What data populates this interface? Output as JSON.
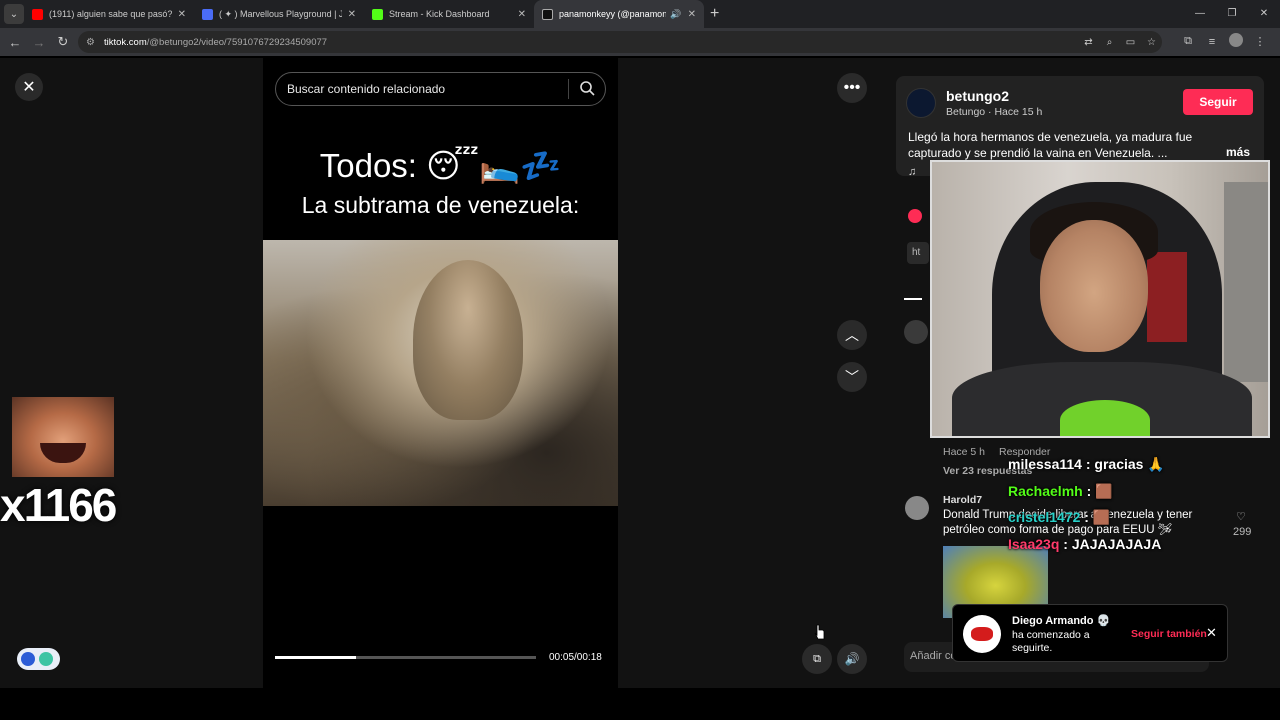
{
  "browser": {
    "tabs": [
      {
        "title": "(1911) alguien sabe que pasó?",
        "fav_color": "#ff0000"
      },
      {
        "title": "( ✦ ) Marvellous Playground | Ju",
        "fav_color": "#4a6cf7"
      },
      {
        "title": "Stream - Kick Dashboard",
        "fav_color": "#53fc18"
      },
      {
        "title": "panamonkeyy (@panamon",
        "fav_color": "#ffffff"
      }
    ],
    "url_domain": "tiktok.com",
    "url_path": "/@betungo2/video/7591076729234509077"
  },
  "video": {
    "search_placeholder": "Buscar contenido relacionado",
    "caption_line1": "Todos: 😴🛌💤",
    "caption_line2": "La subtrama de venezuela:",
    "time": "00:05/00:18",
    "progress": 0.31
  },
  "overlay": {
    "count": "x1166"
  },
  "author": {
    "username": "betungo2",
    "subtitle": "Betungo · Hace 15 h",
    "follow_label": "Seguir",
    "description": "Llegó la hora hermanos de venezuela, ya madura fue capturado y se prendió la vaina en Venezuela. ...",
    "more_label": "más",
    "chip_text": "ht"
  },
  "comments": {
    "first_meta_time": "Hace 5 h",
    "reply_label": "Responder",
    "view_replies": "Ver 23 respuestas",
    "second_user": "Harold7",
    "second_text": "Donald Trump decide liberar a Venezuela y tener petróleo como forma de pago para EEUU 🛩",
    "second_likes": "299"
  },
  "chat": [
    {
      "user": "milessa114",
      "msg": ": gracias 🙏",
      "color": "#ffffff"
    },
    {
      "user": "Rachaelmh",
      "msg": ": 🟫",
      "color": "#53fc18"
    },
    {
      "user": "cristel1472",
      "msg": ": 🟫",
      "color": "#2ad1c9"
    },
    {
      "user": "Isaa23q",
      "msg": ": JAJAJAJAJA",
      "color": "#ff3b6b"
    }
  ],
  "notification": {
    "name": "Diego Armando 💀",
    "text": "ha comenzado a seguirte.",
    "follow_back": "Seguir también"
  },
  "add_comment_placeholder": "Añadir co"
}
